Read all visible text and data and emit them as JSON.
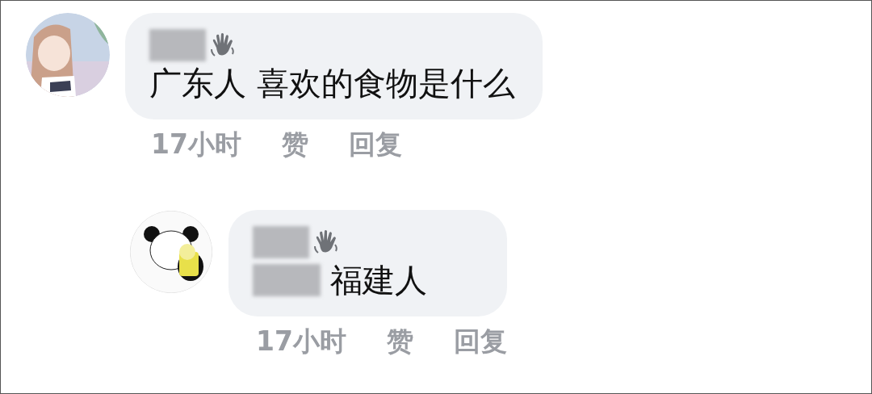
{
  "comments": [
    {
      "kind": "comment",
      "text": "广东人 喜欢的食物是什么",
      "time": "17小时",
      "like": "赞",
      "reply": "回复",
      "children": [
        {
          "kind": "reply",
          "text": "福建人",
          "time": "17小时",
          "like": "赞",
          "reply": "回复"
        }
      ]
    }
  ]
}
